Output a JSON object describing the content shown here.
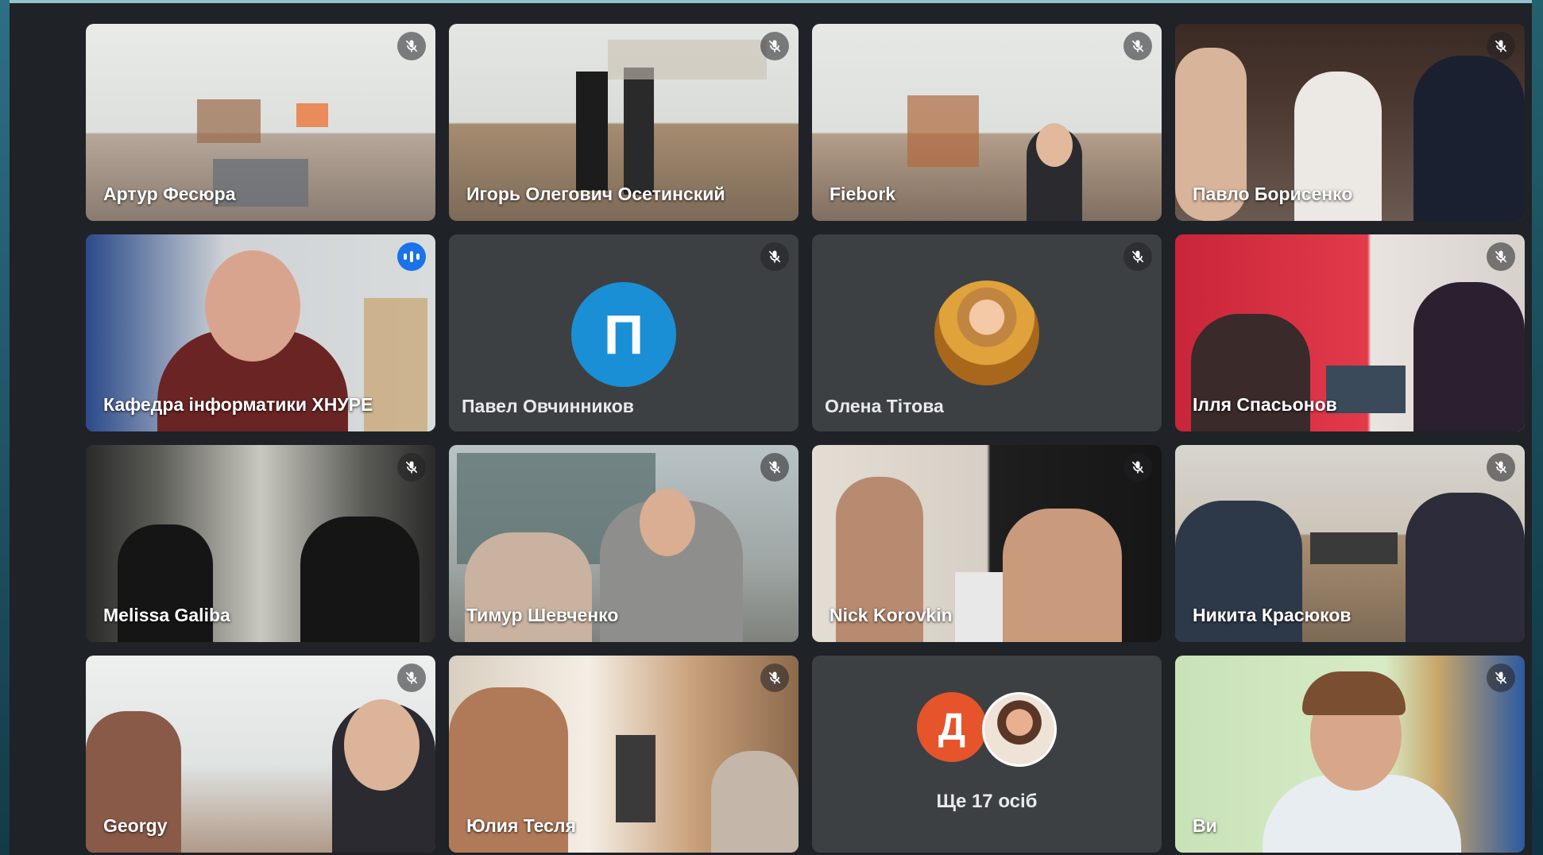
{
  "meeting": {
    "participants": [
      {
        "name": "Артур Фесюра",
        "muted": true,
        "video": true
      },
      {
        "name": "Игорь Олегович Осетинский",
        "muted": true,
        "video": true
      },
      {
        "name": "Fiebork",
        "muted": true,
        "video": true
      },
      {
        "name": "Павло Борисенко",
        "muted": true,
        "video": true
      },
      {
        "name": "Кафедра інформатики ХНУРЕ",
        "muted": false,
        "speaking": true,
        "video": true
      },
      {
        "name": "Павел Овчинников",
        "muted": true,
        "video": false,
        "avatar_letter": "П",
        "avatar_color": "#1a8fd6"
      },
      {
        "name": "Олена Тітова",
        "muted": true,
        "video": false,
        "avatar_photo": true
      },
      {
        "name": "Ілля Спасьонов",
        "muted": true,
        "video": true
      },
      {
        "name": "Melissa Galiba",
        "muted": true,
        "video": true
      },
      {
        "name": "Тимур Шевченко",
        "muted": true,
        "video": true
      },
      {
        "name": "Nick Korovkin",
        "muted": true,
        "video": true
      },
      {
        "name": "Никита Красюков",
        "muted": true,
        "video": true
      },
      {
        "name": "Georgy",
        "muted": true,
        "video": true
      },
      {
        "name": "Юлия Тесля",
        "muted": true,
        "video": true
      },
      {
        "name": "Ви",
        "muted": true,
        "video": true
      }
    ],
    "overflow": {
      "label": "Ще 17 осіб",
      "avatar_letter": "Д",
      "avatar_color": "#e5542a"
    }
  },
  "colors": {
    "background": "#1f2227",
    "tile": "#3c4043",
    "active_border": "#6ea3f2",
    "speaking": "#1a73e8"
  },
  "icons": {
    "muted": "mic-off-icon",
    "speaking": "audio-level-icon"
  }
}
